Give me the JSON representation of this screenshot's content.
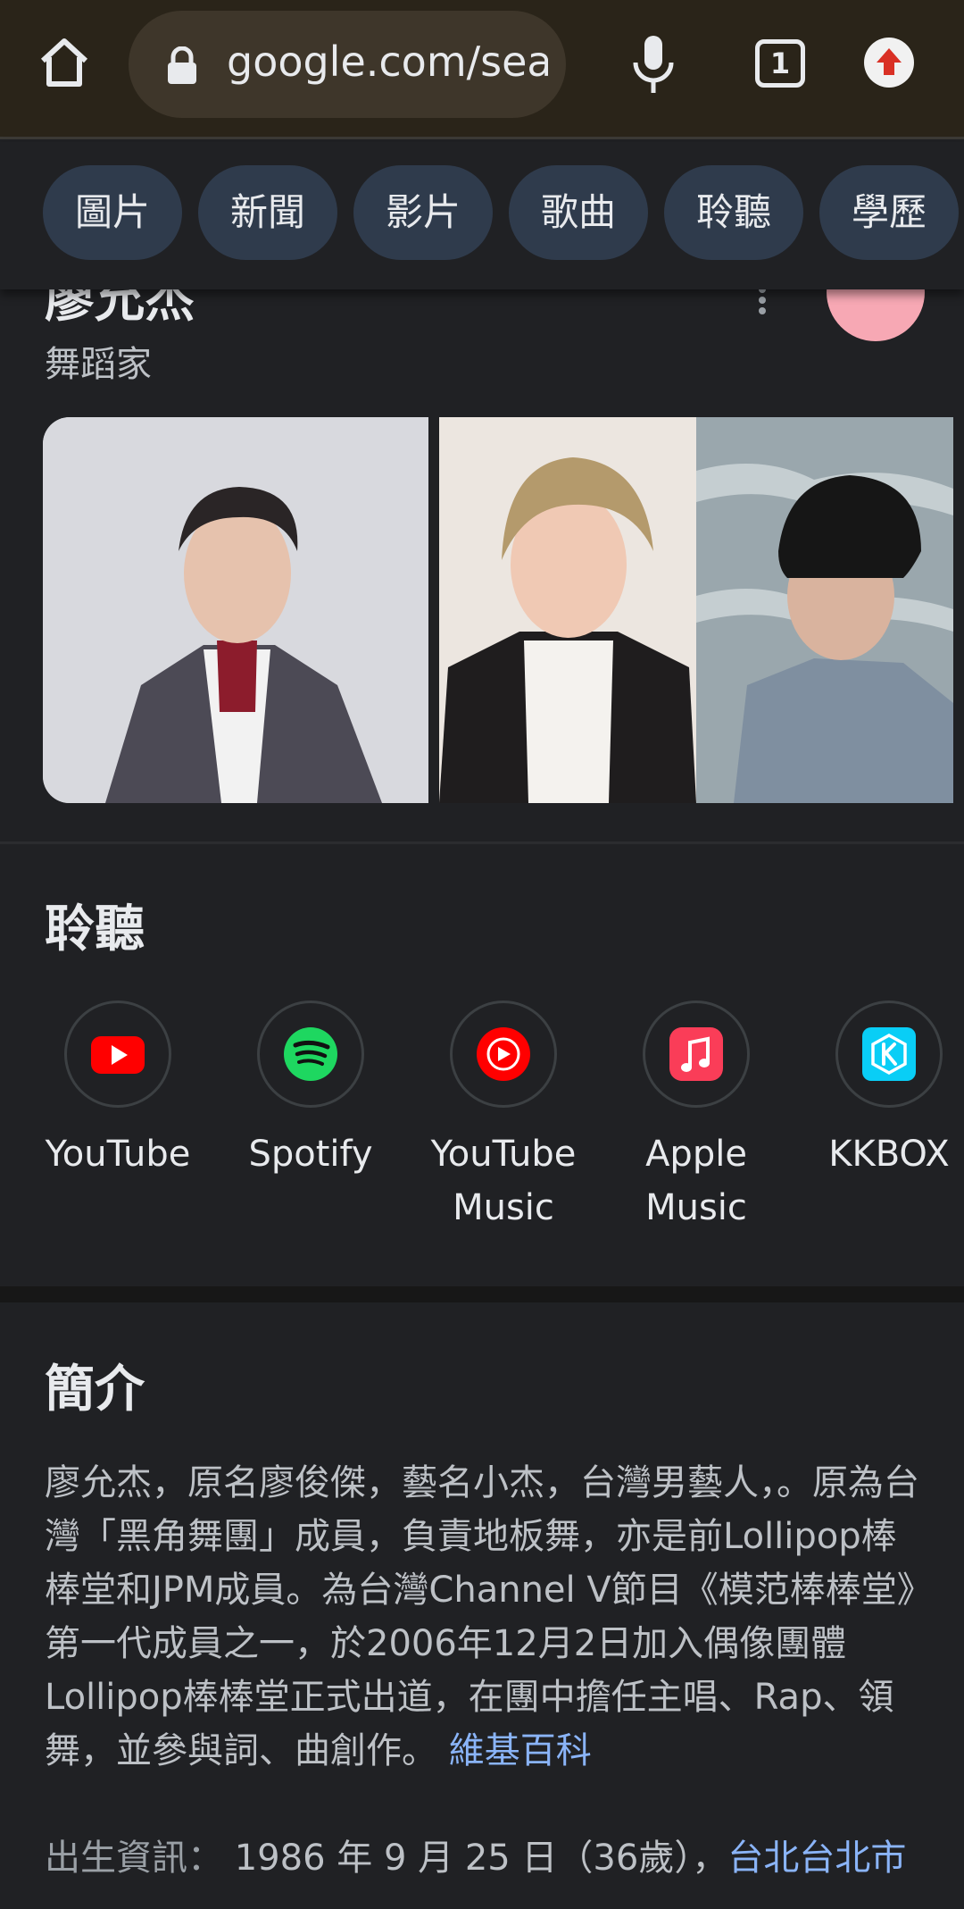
{
  "browser": {
    "url": "google.com/sear",
    "tab_count": "1",
    "icons": [
      "home-icon",
      "lock-icon",
      "mic-icon",
      "tab-switcher-icon",
      "update-icon"
    ]
  },
  "chips": [
    "圖片",
    "新聞",
    "影片",
    "歌曲",
    "聆聽",
    "學歷"
  ],
  "knowledge_panel": {
    "name": "廖允杰",
    "subtitle": "舞蹈家"
  },
  "listen": {
    "title": "聆聽",
    "services": [
      {
        "line1": "YouTube",
        "line2": "",
        "icon": "youtube-icon"
      },
      {
        "line1": "Spotify",
        "line2": "",
        "icon": "spotify-icon"
      },
      {
        "line1": "YouTube",
        "line2": "Music",
        "icon": "youtube-music-icon"
      },
      {
        "line1": "Apple",
        "line2": "Music",
        "icon": "apple-music-icon"
      },
      {
        "line1": "KKBOX",
        "line2": "",
        "icon": "kkbox-icon"
      }
    ]
  },
  "about": {
    "title": "簡介",
    "text": "廖允杰，原名廖俊傑，藝名小杰，台灣男藝人，。原為台灣「黑角舞團」成員，負責地板舞，亦是前Lollipop棒棒堂和JPM成員。為台灣Channel V節目《模范棒棒堂》第一代成員之一，於2006年12月2日加入偶像團體Lollipop棒棒堂正式出道，在團中擔任主唱、Rap、領舞，並參與詞、曲創作。",
    "source_link": "維基百科",
    "birth_label": "出生資訊：",
    "birth_value": "1986 年 9 月 25 日（36歲），",
    "birth_place": "台北台北市"
  },
  "colors": {
    "background": "#202124",
    "link": "#8ab4f8",
    "chip": "#2f3b4c",
    "browser_bar": "#2a2419"
  }
}
